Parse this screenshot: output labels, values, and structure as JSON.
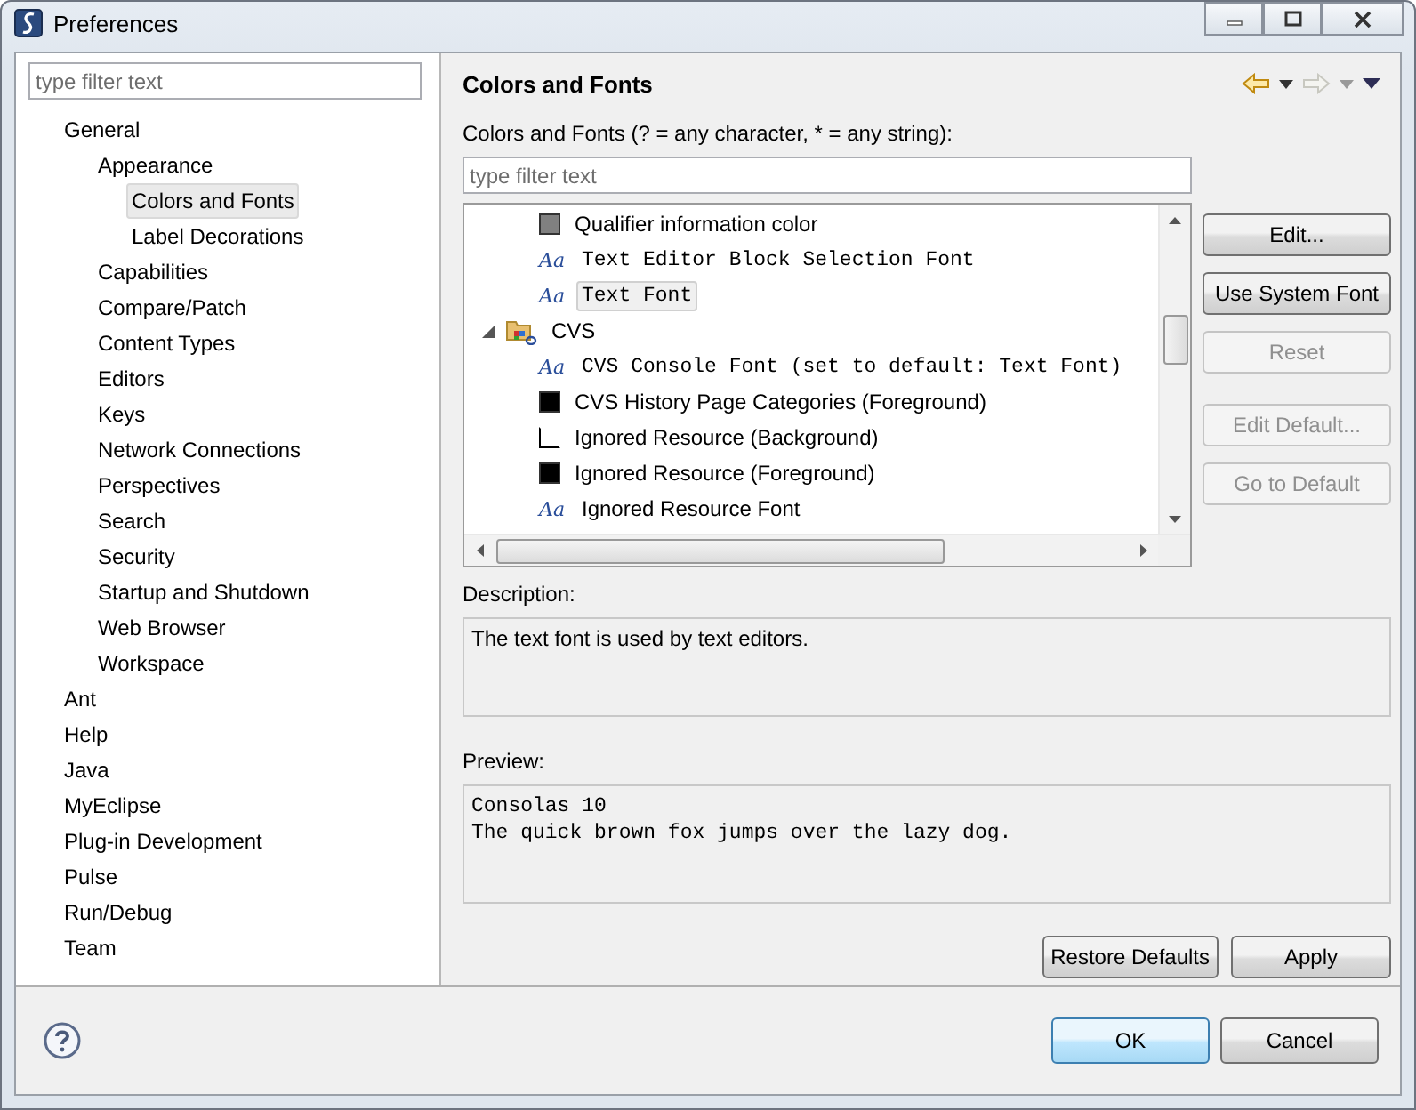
{
  "window": {
    "title": "Preferences"
  },
  "left": {
    "filter": {
      "placeholder": "type filter text"
    },
    "tree": [
      {
        "label": "General",
        "selected": false,
        "children": [
          {
            "label": "Appearance",
            "selected": false,
            "children": [
              {
                "label": "Colors and Fonts",
                "selected": true
              },
              {
                "label": "Label Decorations",
                "selected": false
              }
            ]
          },
          {
            "label": "Capabilities",
            "selected": false
          },
          {
            "label": "Compare/Patch",
            "selected": false
          },
          {
            "label": "Content Types",
            "selected": false
          },
          {
            "label": "Editors",
            "selected": false
          },
          {
            "label": "Keys",
            "selected": false
          },
          {
            "label": "Network Connections",
            "selected": false
          },
          {
            "label": "Perspectives",
            "selected": false
          },
          {
            "label": "Search",
            "selected": false
          },
          {
            "label": "Security",
            "selected": false
          },
          {
            "label": "Startup and Shutdown",
            "selected": false
          },
          {
            "label": "Web Browser",
            "selected": false
          },
          {
            "label": "Workspace",
            "selected": false
          }
        ]
      },
      {
        "label": "Ant",
        "selected": false
      },
      {
        "label": "Help",
        "selected": false
      },
      {
        "label": "Java",
        "selected": false
      },
      {
        "label": "MyEclipse",
        "selected": false
      },
      {
        "label": "Plug-in Development",
        "selected": false
      },
      {
        "label": "Pulse",
        "selected": false
      },
      {
        "label": "Run/Debug",
        "selected": false
      },
      {
        "label": "Team",
        "selected": false
      }
    ]
  },
  "page": {
    "title": "Colors and Fonts",
    "filter_label": "Colors and Fonts (? = any character, * = any string):",
    "filter": {
      "placeholder": "type filter text"
    },
    "list": {
      "continued_rows": [
        {
          "kind": "color",
          "label": "Qualifier information color",
          "color": "#808080",
          "selected": false
        },
        {
          "kind": "font",
          "icon_text": "Aa",
          "label": "Text Editor Block Selection Font",
          "monospace": true,
          "selected": false
        },
        {
          "kind": "font",
          "icon_text": "Aa",
          "label": "Text Font",
          "monospace": true,
          "selected": true
        }
      ],
      "categories": [
        {
          "label": "CVS",
          "expanded": true,
          "children": [
            {
              "kind": "font",
              "icon_text": "Aa",
              "label": "CVS Console Font (set to default: Text Font)",
              "monospace": true,
              "selected": false
            },
            {
              "kind": "color",
              "label": "CVS History Page Categories (Foreground)",
              "color": "#000000",
              "selected": false
            },
            {
              "kind": "color",
              "label": "Ignored Resource (Background)",
              "color": "#ffffff",
              "selected": false
            },
            {
              "kind": "color",
              "label": "Ignored Resource (Foreground)",
              "color": "#000000",
              "selected": false
            },
            {
              "kind": "font",
              "icon_text": "Aa",
              "label": "Ignored Resource Font",
              "monospace": false,
              "selected": false
            }
          ]
        }
      ]
    },
    "side_buttons": [
      {
        "label": "Edit...",
        "disabled": false
      },
      {
        "label": "Use System Font",
        "disabled": false
      },
      {
        "label": "Reset",
        "disabled": true
      },
      {
        "label": "Edit Default...",
        "disabled": true
      },
      {
        "label": "Go to Default",
        "disabled": true
      }
    ],
    "description_label": "Description:",
    "description": "The text font is used by text editors.",
    "preview_label": "Preview:",
    "preview": [
      "Consolas 10",
      "The quick brown fox jumps over the lazy dog."
    ],
    "buttons": [
      "Restore Defaults",
      "Apply"
    ]
  },
  "footer": {
    "buttons": [
      {
        "label": "OK",
        "default": true
      },
      {
        "label": "Cancel",
        "default": false
      }
    ]
  }
}
